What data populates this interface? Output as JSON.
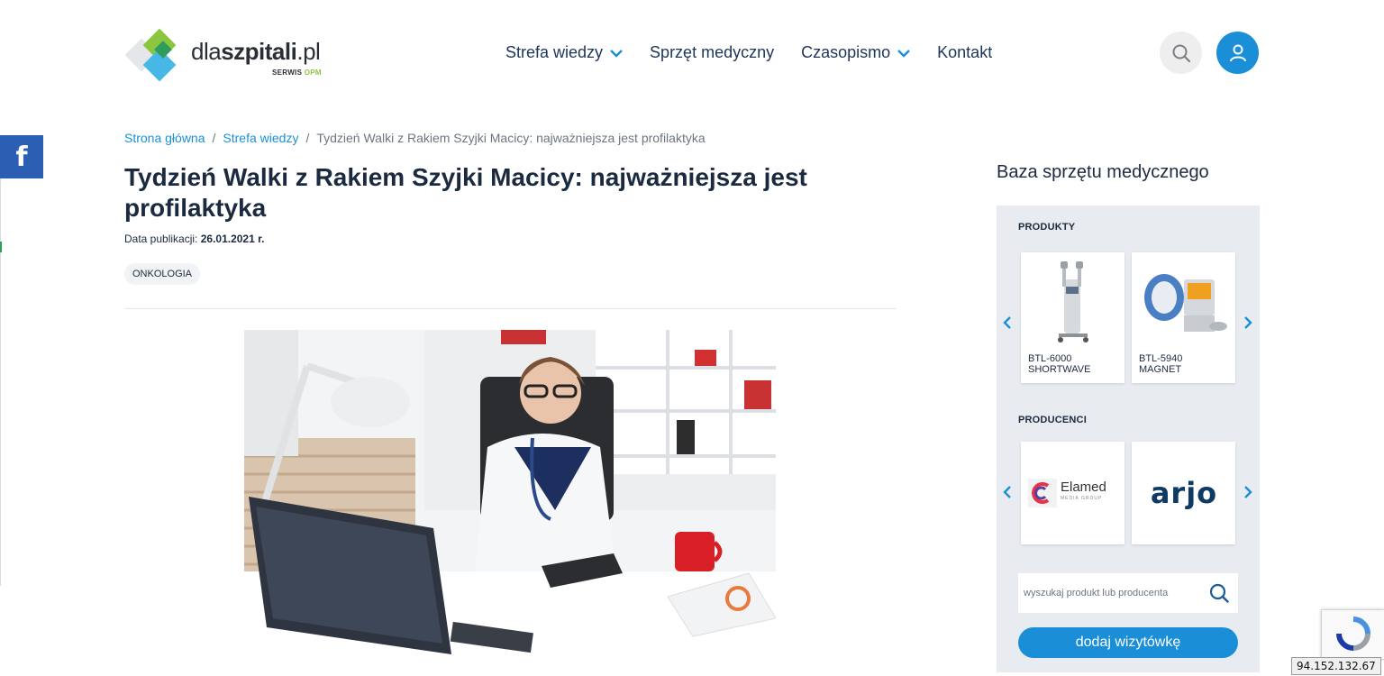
{
  "header": {
    "logo": {
      "text_light": "dla",
      "text_bold": "szpitali",
      "text_tld": ".pl",
      "sub_a": "SERWIS ",
      "sub_b": "OPM"
    },
    "nav": [
      {
        "label": "Strefa wiedzy",
        "has_dropdown": true
      },
      {
        "label": "Sprzęt medyczny",
        "has_dropdown": false
      },
      {
        "label": "Czasopismo",
        "has_dropdown": true
      },
      {
        "label": "Kontakt",
        "has_dropdown": false
      }
    ],
    "search_icon": "search-icon",
    "user_icon": "user-icon"
  },
  "social": {
    "facebook": "f"
  },
  "breadcrumb": {
    "home": "Strona główna",
    "section": "Strefa wiedzy",
    "current": "Tydzień Walki z Rakiem Szyjki Macicy: najważniejsza jest profilaktyka",
    "separator": "/"
  },
  "article": {
    "title": "Tydzień Walki z Rakiem Szyjki Macicy: najważniejsza jest profilaktyka",
    "pub_label": "Data publikacji: ",
    "pub_date": "26.01.2021 r.",
    "tag": "ONKOLOGIA"
  },
  "sidebar": {
    "title": "Baza sprzętu medycznego",
    "products_label": "PRODUKTY",
    "products": [
      {
        "line1": "BTL-6000",
        "line2": "SHORTWAVE"
      },
      {
        "line1": "BTL-5940",
        "line2": "MAGNET"
      }
    ],
    "producers_label": "PRODUCENCI",
    "producers": [
      {
        "name": "Elamed",
        "sub": "MEDIA GROUP"
      },
      {
        "name": "arjo"
      }
    ],
    "search_placeholder": "wyszukaj produkt lub producenta",
    "add_button": "dodaj wizytówkę"
  },
  "ip_badge": "94.152.132.67",
  "colors": {
    "accent": "#1a8fd8",
    "heading": "#1b2a3f",
    "panel": "#e8ecf1",
    "facebook": "#2b5fb3"
  }
}
